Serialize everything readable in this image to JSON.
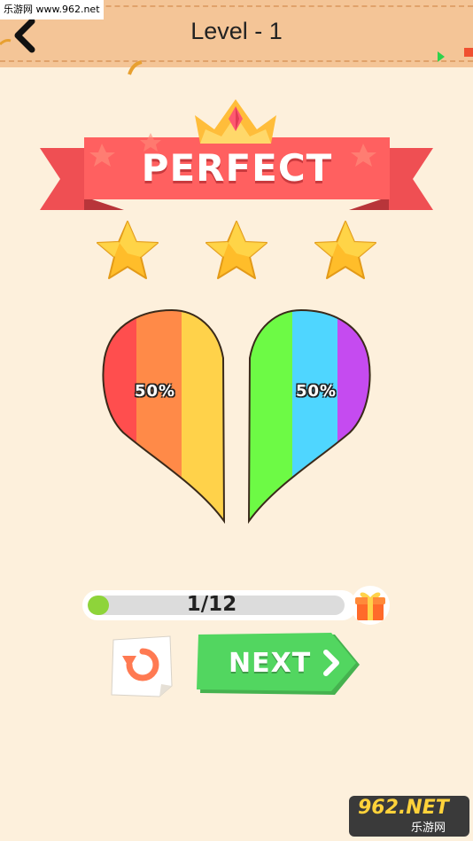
{
  "watermark": "乐游网 www.962.net",
  "header": {
    "title": "Level - 1"
  },
  "result": {
    "banner": "PERFECT",
    "stars_earned": 3,
    "stars_total": 3
  },
  "heart": {
    "left_percent": "50%",
    "right_percent": "50%",
    "left_colors": [
      "#ff4e4e",
      "#ff8a48",
      "#ffd24a"
    ],
    "right_colors": [
      "#6dfa45",
      "#4fd6ff",
      "#c54bf0"
    ]
  },
  "progress": {
    "label": "1/12",
    "current": 1,
    "total": 12,
    "fill_color": "#8ed43a"
  },
  "buttons": {
    "next_label": "NEXT",
    "next_color": "#52d660",
    "restart_color": "#ff7a52"
  },
  "logo": {
    "main": "962.NET",
    "sub": "乐游网"
  },
  "icons": [
    "back-arrow-icon",
    "crown-icon",
    "star-icon",
    "gift-icon",
    "restart-icon",
    "chevron-right-icon"
  ]
}
